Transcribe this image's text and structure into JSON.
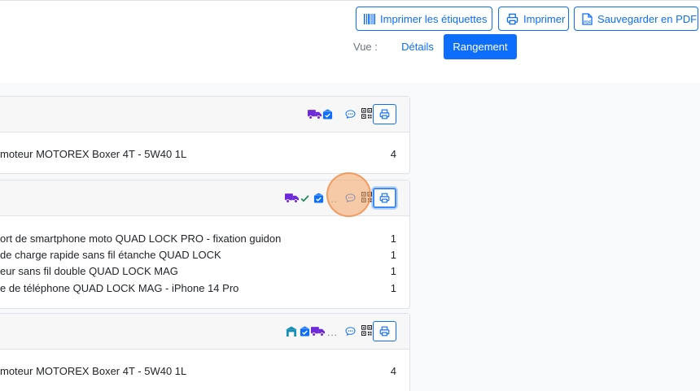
{
  "toolbar": {
    "labels_button": "Imprimer les étiquettes",
    "print_button": "Imprimer",
    "pdf_button": "Sauvegarder en PDF"
  },
  "view": {
    "label": "Vue :",
    "options": [
      "Détails",
      "Rangement"
    ],
    "selected": "Rangement"
  },
  "orders": [
    {
      "status_icons": [
        "delivery-truck-icon",
        "box-check-icon"
      ],
      "items": [
        {
          "name": "moteur MOTOREX Boxer 4T - 5W40 1L",
          "qty": "4"
        }
      ]
    },
    {
      "status_icons": [
        "delivery-truck-icon",
        "check-icon",
        "box-check-icon"
      ],
      "ellipsis": "...",
      "items": [
        {
          "name": "ort de smartphone moto QUAD LOCK PRO - fixation guidon",
          "qty": "1"
        },
        {
          "name": "de charge rapide sans fil étanche QUAD LOCK",
          "qty": "1"
        },
        {
          "name": "eur sans fil double QUAD LOCK MAG",
          "qty": "1"
        },
        {
          "name": "e de téléphone QUAD LOCK MAG - iPhone 14 Pro",
          "qty": "1"
        }
      ]
    },
    {
      "status_icons": [
        "store-icon",
        "box-check-icon",
        "delivery-truck-icon"
      ],
      "ellipsis": "...",
      "items": [
        {
          "name": "moteur MOTOREX Boxer 4T - 5W40 1L",
          "qty": "4"
        }
      ]
    }
  ],
  "colors": {
    "primary": "#0d6efd",
    "truck": "#6f2bd9",
    "check": "#198754",
    "store": "#1a8fb5",
    "cursor": "#f5a665"
  }
}
